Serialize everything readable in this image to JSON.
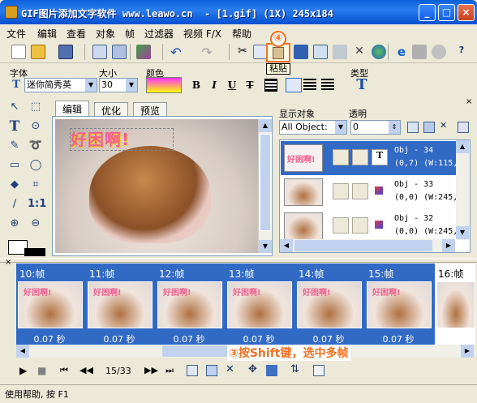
{
  "window": {
    "title": "GIF图片添加文字软件 www.leawo.cn  - [1.gif] (1X) 245x184",
    "min": "_",
    "max": "□",
    "close": "×"
  },
  "menu": [
    "文件",
    "编辑",
    "查看",
    "对象",
    "帧",
    "过滤器",
    "视频 F/X",
    "帮助"
  ],
  "callouts": {
    "step4": "④",
    "paste_tooltip": "粘贴",
    "step3": "③按Shift键，选中多帧"
  },
  "format": {
    "font_label": "字体",
    "font_value": "迷你简秀英",
    "size_label": "大小",
    "size_value": "30",
    "color_label": "颜色",
    "type_label": "类型",
    "bold": "B",
    "italic": "I",
    "underline": "U",
    "strike": "T",
    "color_gradient": [
      "#ff30ff",
      "#ffff00"
    ]
  },
  "tabs": [
    "编辑",
    "优化",
    "预览"
  ],
  "canvas": {
    "text": "好困啊!"
  },
  "objects_panel": {
    "show_label": "显示对象",
    "show_value": "All Object:",
    "alpha_label": "透明",
    "alpha_value": "0",
    "rows": [
      {
        "thumb_text": "好困啊!",
        "line1": "Obj - 34",
        "line2": "(0,7) (W:115,H"
      },
      {
        "thumb_text": "",
        "line1": "Obj - 33",
        "line2": "(0,0) (W:245,H"
      },
      {
        "thumb_text": "",
        "line1": "Obj - 32",
        "line2": "(0,0) (W:245,H"
      }
    ]
  },
  "frames": [
    {
      "label": "10:帧",
      "time": "0.07 秒",
      "text": "好困啊!"
    },
    {
      "label": "11:帧",
      "time": "0.07 秒",
      "text": "好困啊!"
    },
    {
      "label": "12:帧",
      "time": "0.07 秒",
      "text": "好困啊!"
    },
    {
      "label": "13:帧",
      "time": "0.07 秒",
      "text": "好困啊!"
    },
    {
      "label": "14:帧",
      "time": "0.07 秒",
      "text": "好困啊!"
    },
    {
      "label": "15:帧",
      "time": "0.07 秒",
      "text": "好困啊!"
    },
    {
      "label": "16:帧",
      "time": "",
      "text": ""
    }
  ],
  "playback": {
    "frame_counter": "15/33"
  },
  "status": {
    "text": "使用帮助, 按 F1"
  }
}
